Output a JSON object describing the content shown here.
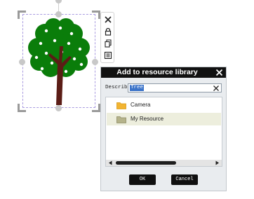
{
  "icons": {
    "toolbar": [
      "close-icon",
      "lock-icon",
      "copy-icon",
      "properties-icon"
    ]
  },
  "colors": {
    "tree_foliage": "#0a7d0a",
    "tree_trunk": "#5b1d16",
    "dialog_title_bg": "#111111",
    "folder_camera": "#f2b431",
    "folder_myresource": "#b5b38a",
    "selection_border": "#a99be0"
  },
  "dialog": {
    "title": "Add to resource library",
    "describe_label": "Describe",
    "describe_value": "Tree",
    "folders": [
      {
        "name": "Camera",
        "selected": false
      },
      {
        "name": "My Resource",
        "selected": true
      }
    ],
    "ok_label": "OK",
    "cancel_label": "Cancel"
  }
}
